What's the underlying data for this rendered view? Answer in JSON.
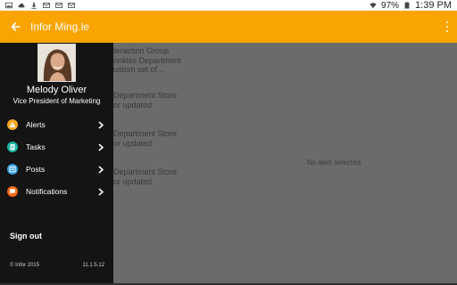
{
  "status_bar": {
    "battery": "97%",
    "time": "1:39 PM"
  },
  "app_bar": {
    "title": "Infor Ming.le",
    "color": "#f9a400"
  },
  "drawer": {
    "profile": {
      "name": "Melody Oliver",
      "title": "Vice President of Marketing"
    },
    "nav_items": [
      {
        "label": "Alerts",
        "icon": "warning-icon",
        "color": "#f5a623"
      },
      {
        "label": "Tasks",
        "icon": "clipboard-icon",
        "color": "#19b5a5"
      },
      {
        "label": "Posts",
        "icon": "posts-icon",
        "color": "#2f9fe0"
      },
      {
        "label": "Notifications",
        "icon": "chat-bubble-icon",
        "color": "#f26a1b"
      }
    ],
    "sign_out": "Sign out",
    "copyright": "© Infor 2015",
    "version": "11.1.5.12"
  },
  "background_list": {
    "items": [
      {
        "line1": "teraction Group",
        "line2": "rinkles Department",
        "line3": "ustom set of..."
      },
      {
        "line1": "Department Store",
        "line2": "or updated"
      },
      {
        "line1": "Department Store",
        "line2": "or updated"
      },
      {
        "line1": "Department Store",
        "line2": "or updated"
      }
    ]
  },
  "detail": {
    "empty_text": "No alert selected."
  }
}
